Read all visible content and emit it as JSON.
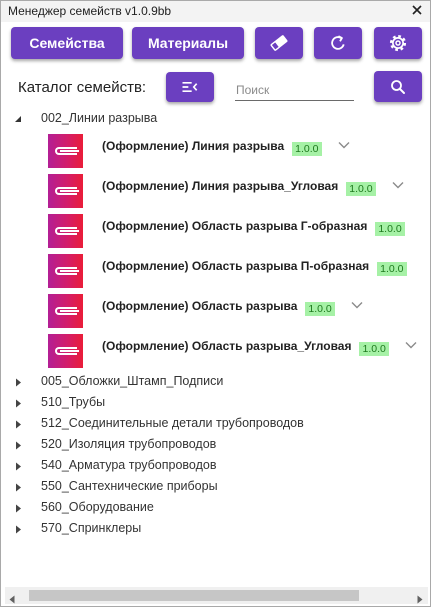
{
  "window": {
    "title": "Менеджер семейств v1.0.9bb",
    "close_icon": "close-icon"
  },
  "colors": {
    "accent": "#6b3fc0",
    "badge_bg": "#a6f1a6",
    "badge_text": "#1e7a1e",
    "thumb_start": "#b31f95",
    "thumb_end": "#ea1d38"
  },
  "toolbar": {
    "families_label": "Семейства",
    "materials_label": "Материалы",
    "icon_buttons": [
      "eraser-icon",
      "refresh-icon",
      "gear-icon"
    ]
  },
  "catalog": {
    "label": "Каталог семейств:",
    "collapse_icon": "collapse-list-icon",
    "search_placeholder": "Поиск",
    "search_value": "",
    "search_icon": "search-icon"
  },
  "tree": {
    "nodes": [
      {
        "label": "002_Линии разрыва",
        "expanded": true,
        "children": [
          {
            "name": "(Оформление) Линия разрыва",
            "version": "1.0.0",
            "expander": true
          },
          {
            "name": "(Оформление) Линия разрыва_Угловая",
            "version": "1.0.0",
            "expander": true
          },
          {
            "name": "(Оформление) Область разрыва Г-образная",
            "version": "1.0.0",
            "expander": false
          },
          {
            "name": "(Оформление) Область разрыва П-образная",
            "version": "1.0.0",
            "expander": false
          },
          {
            "name": "(Оформление) Область разрыва",
            "version": "1.0.0",
            "expander": true
          },
          {
            "name": "(Оформление) Область разрыва_Угловая",
            "version": "1.0.0",
            "expander": true
          }
        ]
      },
      {
        "label": "005_Обложки_Штамп_Подписи",
        "expanded": false
      },
      {
        "label": "510_Трубы",
        "expanded": false
      },
      {
        "label": "512_Соединительные детали трубопроводов",
        "expanded": false
      },
      {
        "label": "520_Изоляция трубопроводов",
        "expanded": false
      },
      {
        "label": "540_Арматура трубопроводов",
        "expanded": false
      },
      {
        "label": "550_Сантехнические приборы",
        "expanded": false
      },
      {
        "label": "560_Оборудование",
        "expanded": false
      },
      {
        "label": "570_Спринклеры",
        "expanded": false
      }
    ]
  }
}
